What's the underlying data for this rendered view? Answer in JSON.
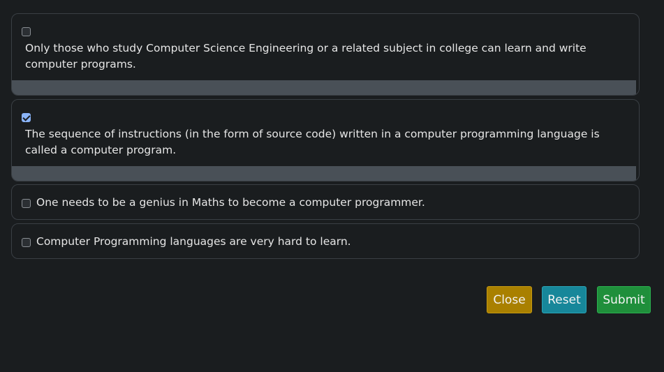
{
  "options": [
    {
      "text": "Only those who study Computer Science Engineering or a related subject in college can learn and write computer programs.",
      "checked": false
    },
    {
      "text": "The sequence of instructions (in the form of source code) written in a computer programming language is called a computer program.",
      "checked": true
    },
    {
      "text": "One needs to be a genius in Maths to become a computer programmer.",
      "checked": false
    },
    {
      "text": "Computer Programming languages are very hard to learn.",
      "checked": false
    }
  ],
  "buttons": {
    "close": "Close",
    "reset": "Reset",
    "submit": "Submit"
  },
  "colors": {
    "background": "#1a1d1f",
    "checkbox_checked": "#8ab4f8",
    "close": "#a98000",
    "reset": "#17879a",
    "submit": "#1f8f3b",
    "option_footer": "#495057"
  }
}
